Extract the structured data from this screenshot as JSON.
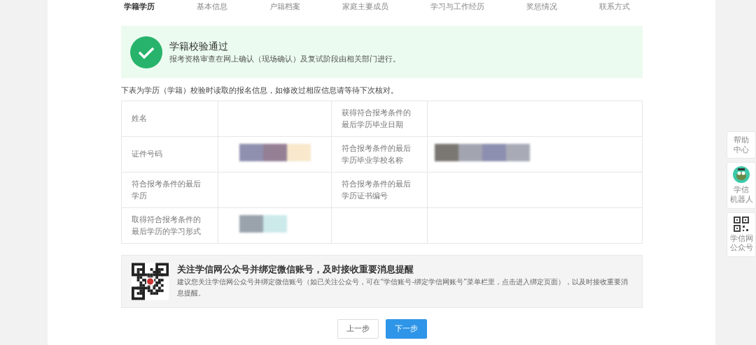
{
  "steps": [
    {
      "label": "学籍学历",
      "selected": true
    },
    {
      "label": "基本信息",
      "selected": false
    },
    {
      "label": "户籍档案",
      "selected": false
    },
    {
      "label": "家庭主要成员",
      "selected": false
    },
    {
      "label": "学习与工作经历",
      "selected": false
    },
    {
      "label": "奖惩情况",
      "selected": false
    },
    {
      "label": "联系方式",
      "selected": false
    }
  ],
  "alert": {
    "title": "学籍校验通过",
    "message": "报考资格审查在网上确认（现场确认）及复试阶段由相关部门进行。"
  },
  "table_note": "下表为学历（学籍）校验时读取的报名信息，如修改过相应信息请等待下次核对。",
  "table": {
    "rows": [
      [
        {
          "label": "姓名"
        },
        {
          "label": "获得符合报考条件的最后学历毕业日期"
        }
      ],
      [
        {
          "label": "证件号码",
          "redacted": true
        },
        {
          "label": "符合报考条件的最后学历毕业学校名称",
          "redacted": true
        }
      ],
      [
        {
          "label": "符合报考条件的最后学历"
        },
        {
          "label": "符合报考条件的最后学历证书编号"
        }
      ],
      [
        {
          "label": "取得符合报考条件的最后学历的学习形式",
          "redacted": true
        }
      ]
    ]
  },
  "notice": {
    "title": "关注学信网公众号并绑定微信账号，及时接收重要消息提醒",
    "text": "建议您关注学信网公众号并绑定微信账号（如已关注公众号，可在“学信账号-绑定学信网账号”菜单栏里，点击进入绑定页面），以及时接收重要消息提醒。"
  },
  "buttons": [
    {
      "label": "上一步",
      "kind": "secondary"
    },
    {
      "label": "下一步",
      "kind": "primary"
    }
  ],
  "side_panel": [
    {
      "lines": [
        "帮助",
        "中心"
      ],
      "kind": "text"
    },
    {
      "lines": [
        "学信",
        "机器人"
      ],
      "kind": "robot"
    },
    {
      "lines": [
        "学信网",
        "公众号"
      ],
      "kind": "qr"
    }
  ]
}
